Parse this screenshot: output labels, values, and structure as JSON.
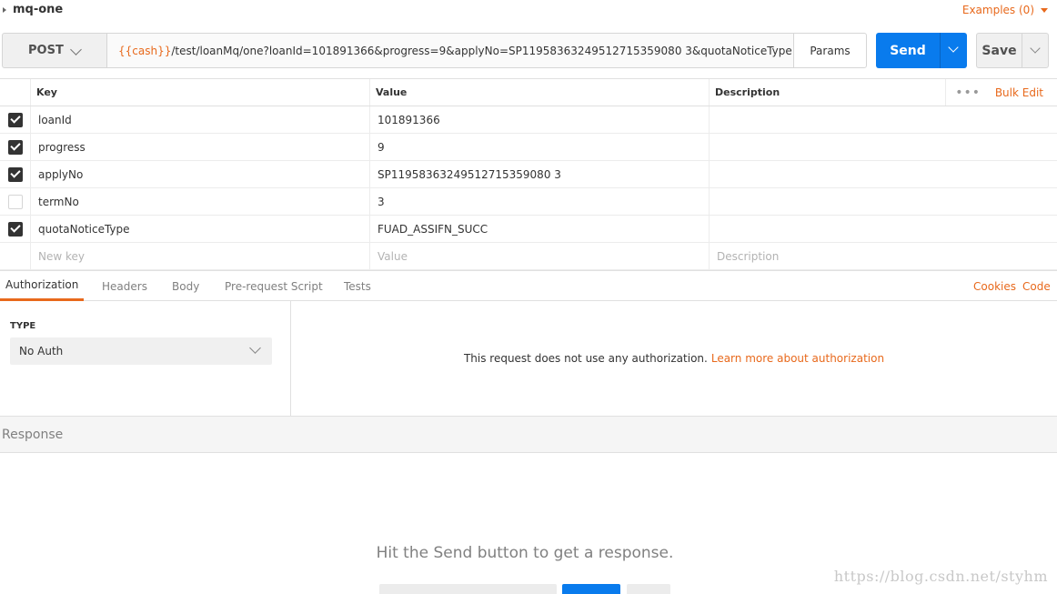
{
  "request": {
    "title": "mq-one",
    "examples_label": "Examples (0)",
    "method": "POST",
    "url_var": "{{cash}}",
    "url_rest": "/test/loanMq/one?loanId=101891366&progress=9&applyNo=SP11958363249512715359080 3&quotaNoticeType=FUAD_AS..",
    "params_label": "Params",
    "send_label": "Send",
    "save_label": "Save"
  },
  "params_table": {
    "headers": {
      "key": "Key",
      "value": "Value",
      "description": "Description"
    },
    "more_label": "•••",
    "bulk_edit_label": "Bulk Edit",
    "rows": [
      {
        "checked": true,
        "key": "loanId",
        "value": "101891366",
        "description": ""
      },
      {
        "checked": true,
        "key": "progress",
        "value": "9",
        "description": ""
      },
      {
        "checked": true,
        "key": "applyNo",
        "value": "SP11958363249512715359080 3",
        "description": ""
      },
      {
        "checked": false,
        "key": "termNo",
        "value": "3",
        "description": ""
      },
      {
        "checked": true,
        "key": "quotaNoticeType",
        "value": "FUAD_ASSIFN_SUCC",
        "description": ""
      }
    ],
    "new_row": {
      "key_placeholder": "New key",
      "value_placeholder": "Value",
      "description_placeholder": "Description"
    }
  },
  "tabs": {
    "items": [
      "Authorization",
      "Headers",
      "Body",
      "Pre-request Script",
      "Tests"
    ],
    "active": "Authorization",
    "cookies_label": "Cookies",
    "code_label": "Code"
  },
  "auth": {
    "type_label": "TYPE",
    "type_value": "No Auth",
    "message": "This request does not use any authorization.",
    "learn_more": "Learn more about authorization"
  },
  "response": {
    "label": "Response",
    "empty_message": "Hit the Send button to get a response."
  },
  "watermark": "https://blog.csdn.net/styhm",
  "colors": {
    "accent": "#e8691c",
    "send": "#097bed"
  }
}
